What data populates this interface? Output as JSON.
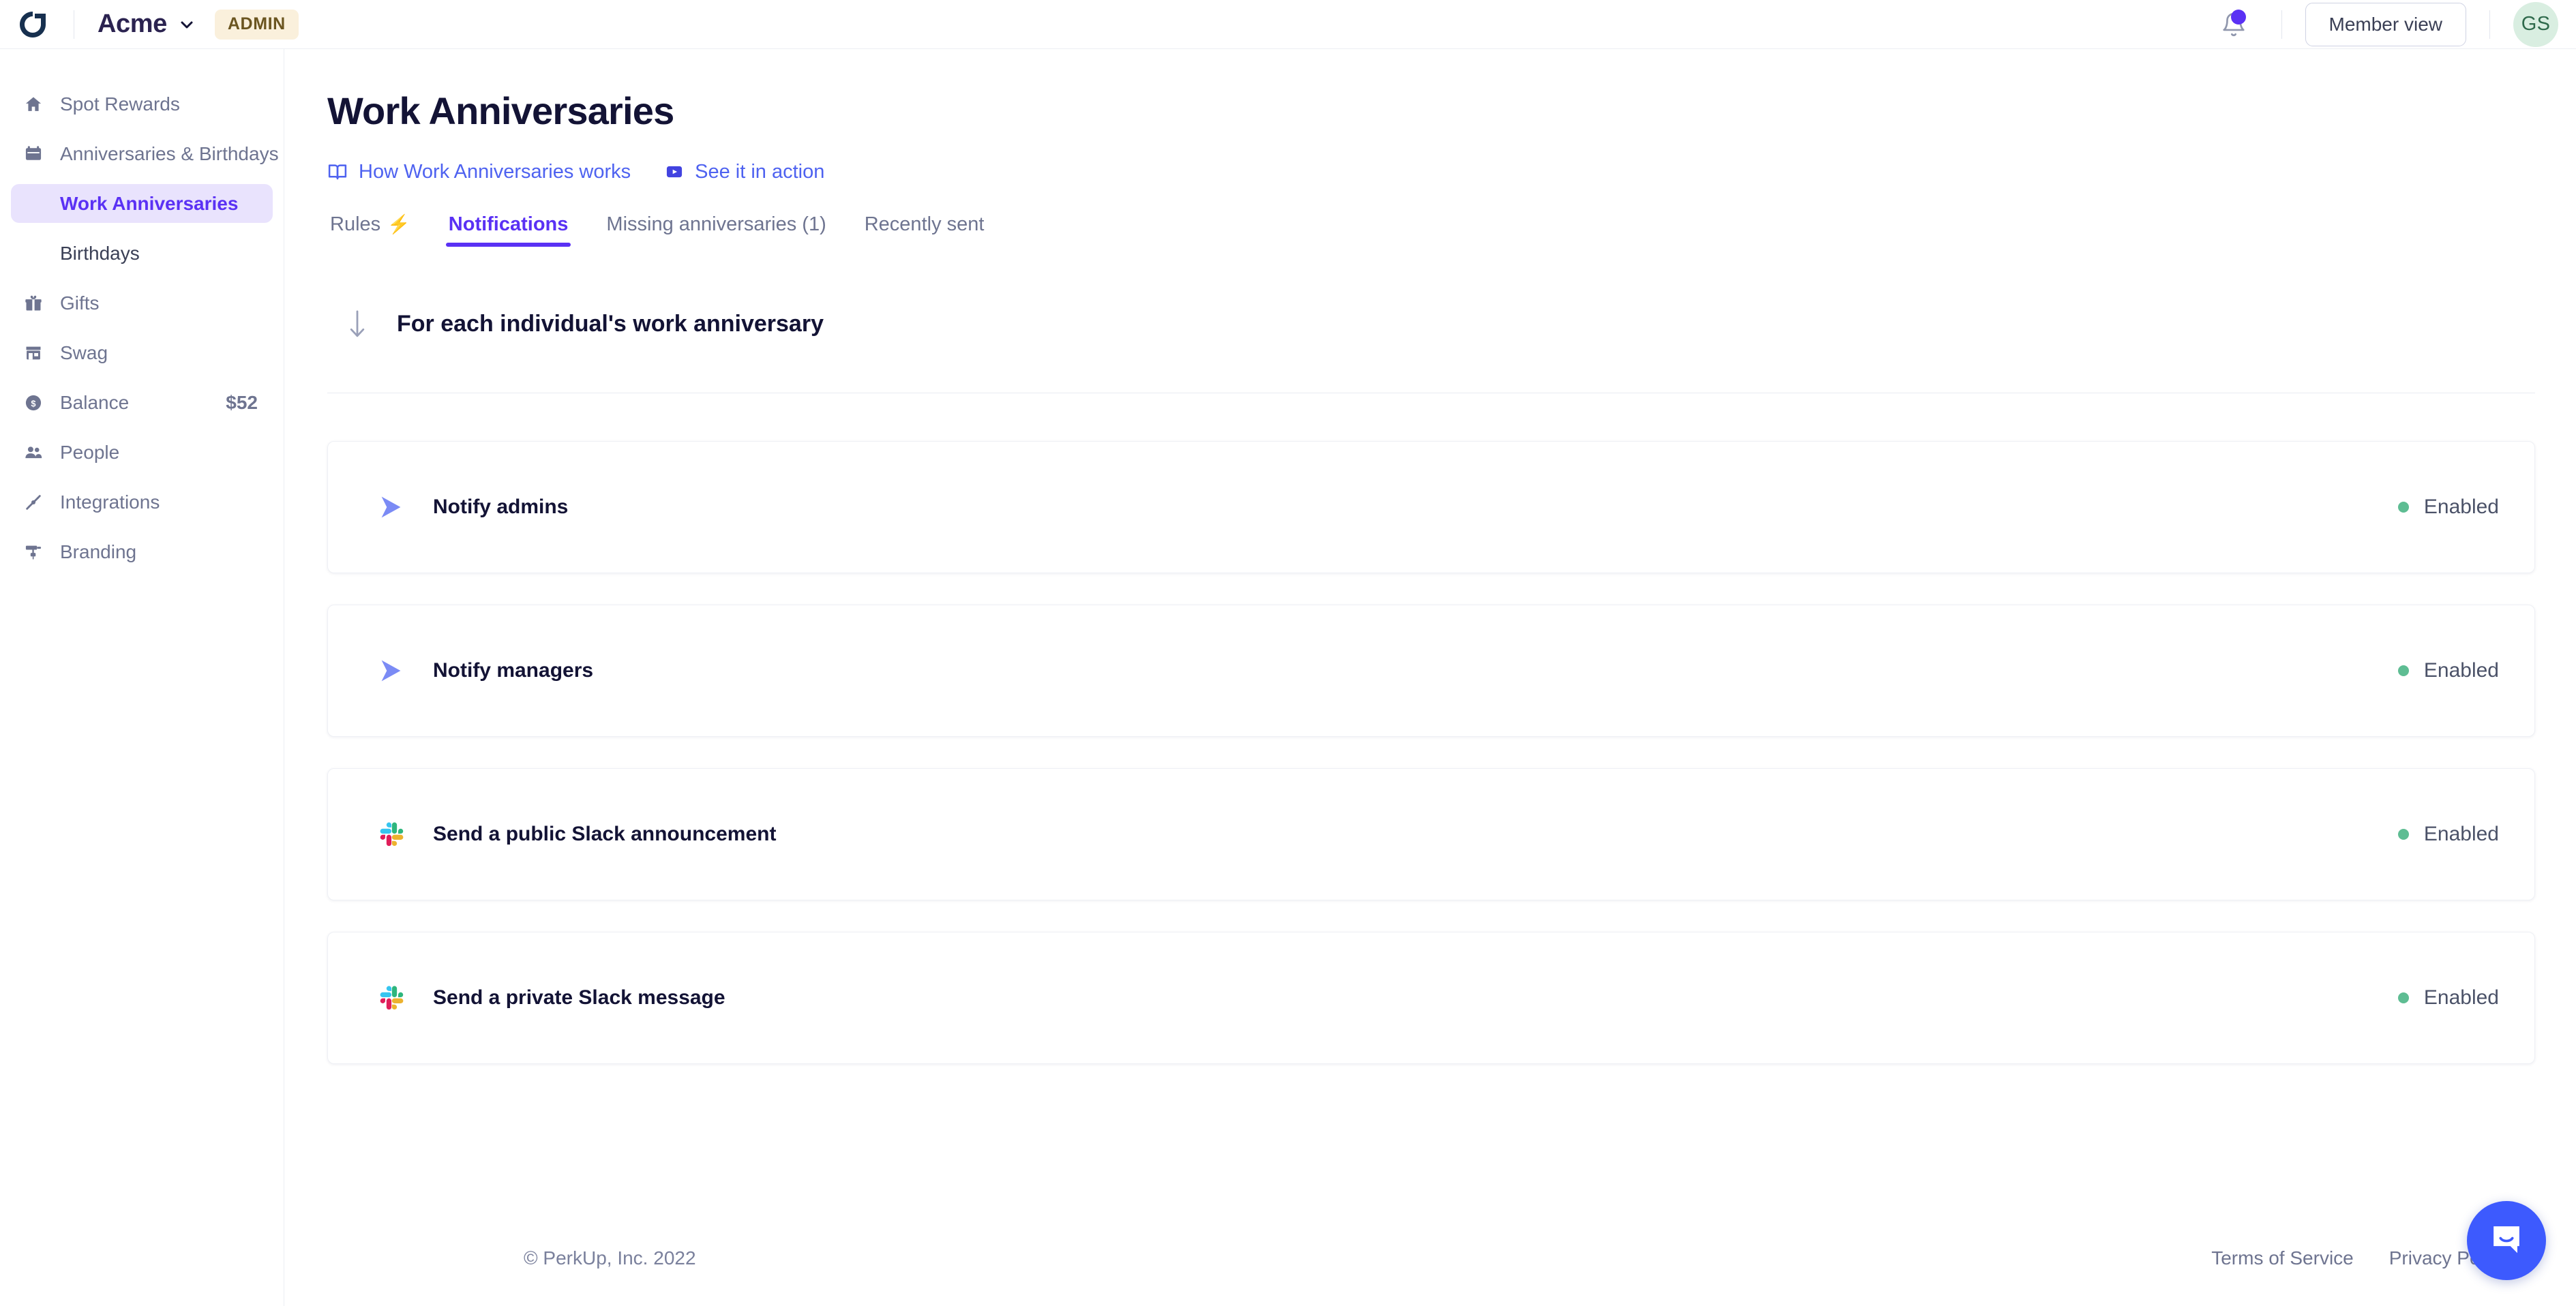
{
  "topbar": {
    "logo_icon": "perkup-logo-icon",
    "org_name": "Acme",
    "org_chevron_icon": "chevron-down-icon",
    "admin_badge": "ADMIN",
    "bell_icon": "bell-icon",
    "member_view_label": "Member view",
    "avatar_initials": "GS"
  },
  "sidebar": {
    "items": [
      {
        "label": "Spot Rewards",
        "icon": "home-icon",
        "value": ""
      },
      {
        "label": "Anniversaries & Birthdays",
        "icon": "calendar-icon",
        "value": ""
      },
      {
        "label": "Gifts",
        "icon": "gift-icon",
        "value": ""
      },
      {
        "label": "Swag",
        "icon": "store-icon",
        "value": ""
      },
      {
        "label": "Balance",
        "icon": "dollar-coin-icon",
        "value": "$52"
      },
      {
        "label": "People",
        "icon": "people-icon",
        "value": ""
      },
      {
        "label": "Integrations",
        "icon": "plug-icon",
        "value": ""
      },
      {
        "label": "Branding",
        "icon": "paint-roller-icon",
        "value": ""
      }
    ],
    "subitems": [
      {
        "label": "Work Anniversaries",
        "active": true
      },
      {
        "label": "Birthdays",
        "active": false
      }
    ]
  },
  "main": {
    "page_title": "Work Anniversaries",
    "help_links": [
      {
        "label": "How Work Anniversaries works",
        "icon": "book-icon"
      },
      {
        "label": "See it in action",
        "icon": "video-play-icon"
      }
    ],
    "tabs": [
      {
        "label": "Rules",
        "suffix": "⚡",
        "active": false
      },
      {
        "label": "Notifications",
        "suffix": "",
        "active": true
      },
      {
        "label": "Missing anniversaries (1)",
        "suffix": "",
        "active": false
      },
      {
        "label": "Recently sent",
        "suffix": "",
        "active": false
      }
    ],
    "section": {
      "arrow_icon": "arrow-down-icon",
      "title": "For each individual's work anniversary"
    },
    "notification_cards": [
      {
        "label": "Notify admins",
        "icon": "send-arrow-icon",
        "status": "Enabled"
      },
      {
        "label": "Notify managers",
        "icon": "send-arrow-icon",
        "status": "Enabled"
      },
      {
        "label": "Send a public Slack announcement",
        "icon": "slack-icon",
        "status": "Enabled"
      },
      {
        "label": "Send a private Slack message",
        "icon": "slack-icon",
        "status": "Enabled"
      }
    ]
  },
  "footer": {
    "copyright": "© PerkUp, Inc. 2022",
    "links": [
      {
        "label": "Terms of Service"
      },
      {
        "label": "Privacy Policy"
      }
    ]
  },
  "widget": {
    "intercom_icon": "intercom-chat-icon"
  },
  "colors": {
    "accent_purple": "#5A31F4",
    "link_blue": "#4e62f0",
    "status_green": "#5ebd93",
    "admin_badge_bg": "#faf0dc",
    "admin_badge_text": "#6b5520",
    "intercom_blue": "#3D5AFE",
    "title_navy": "#131335"
  }
}
